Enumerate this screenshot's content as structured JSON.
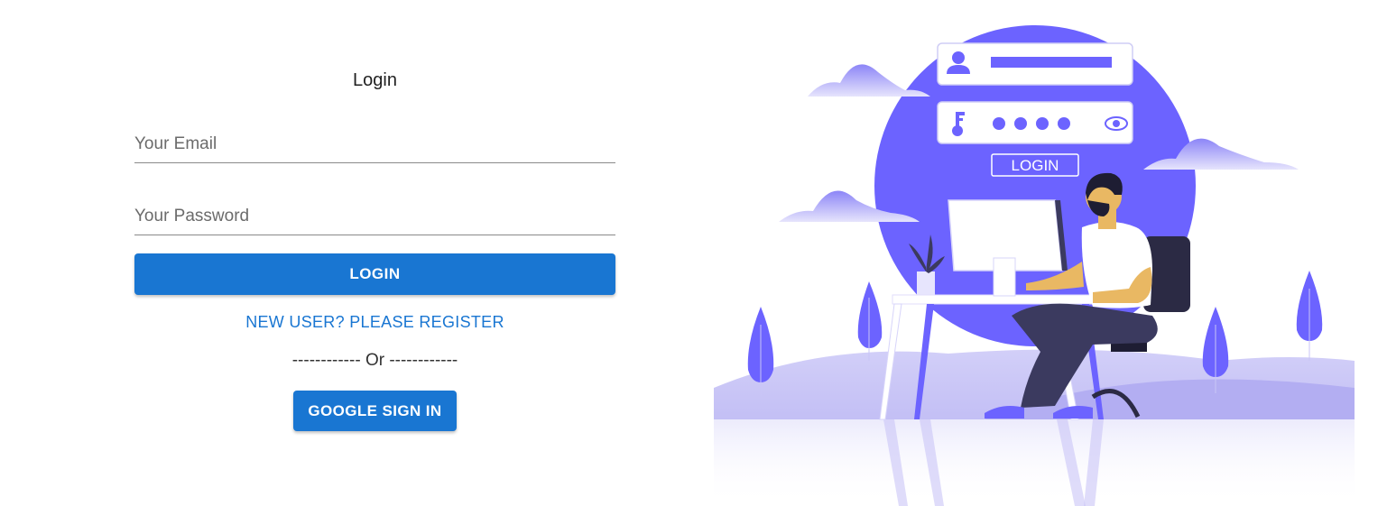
{
  "form": {
    "title": "Login",
    "email_placeholder": "Your Email",
    "password_placeholder": "Your Password",
    "email_value": "",
    "password_value": "",
    "login_label": "LOGIN",
    "register_label": "NEW USER? PLEASE REGISTER",
    "or_label": "------------ Or ------------",
    "google_label": "GOOGLE SIGN IN"
  },
  "illustration": {
    "login_text": "LOGIN"
  },
  "colors": {
    "primary": "#1976d2",
    "illustration_purple": "#6c63ff"
  }
}
